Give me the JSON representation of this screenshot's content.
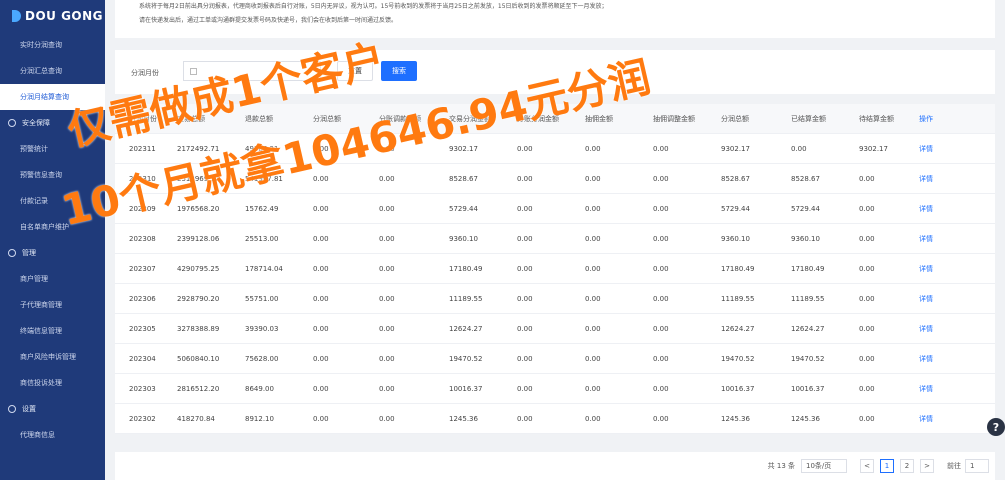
{
  "brand": "DOU GONG",
  "sidebar": {
    "items": [
      {
        "label": "实时分润查询",
        "type": "item"
      },
      {
        "label": "分润汇总查询",
        "type": "item"
      },
      {
        "label": "分润月结算查询",
        "type": "item",
        "active": true
      },
      {
        "label": "安全保障",
        "type": "group"
      },
      {
        "label": "预警统计",
        "type": "item"
      },
      {
        "label": "预警信息查询",
        "type": "item"
      },
      {
        "label": "付款记录",
        "type": "item"
      },
      {
        "label": "自名单商户维护",
        "type": "item"
      },
      {
        "label": "管理",
        "type": "group"
      },
      {
        "label": "商户管理",
        "type": "item"
      },
      {
        "label": "子代理商管理",
        "type": "item"
      },
      {
        "label": "终端信息管理",
        "type": "item"
      },
      {
        "label": "商户风险申诉管理",
        "type": "item"
      },
      {
        "label": "商信投诉处理",
        "type": "item"
      },
      {
        "label": "设置",
        "type": "group"
      },
      {
        "label": "代理商信息",
        "type": "item"
      }
    ]
  },
  "notice": {
    "line1": "系统将于每月2日前出具分润报表，代理商收到报表后自行对账，5日内无异议，视为认可。15号前收到的发票将于当月25日之前发放，15日后收到的发票将顺延至下一月发放；",
    "line2": "请在快递发出后，通过工单或沟通群提交发票号码及快递号，我们会在收到后第一时间通过反馈。"
  },
  "filter": {
    "label": "分润月份",
    "reset": "重置",
    "search": "搜索"
  },
  "table": {
    "headers": [
      "分润月份",
      "交易总额",
      "退款总额",
      "分润总额",
      "分账调款总额",
      "交易分润金额",
      "分账分润金额",
      "抽佣金额",
      "抽佣调整金额",
      "分润总额",
      "已结算金额",
      "待结算金额",
      "操作"
    ],
    "rows": [
      [
        "202311",
        "2172492.71",
        "49386.21",
        "0.00",
        "0.00",
        "9302.17",
        "0.00",
        "0.00",
        "0.00",
        "9302.17",
        "0.00",
        "9302.17",
        "详情"
      ],
      [
        "202310",
        "2513969.77",
        "541967.81",
        "0.00",
        "0.00",
        "8528.67",
        "0.00",
        "0.00",
        "0.00",
        "8528.67",
        "8528.67",
        "0.00",
        "详情"
      ],
      [
        "202309",
        "1976568.20",
        "15762.49",
        "0.00",
        "0.00",
        "5729.44",
        "0.00",
        "0.00",
        "0.00",
        "5729.44",
        "5729.44",
        "0.00",
        "详情"
      ],
      [
        "202308",
        "2399128.06",
        "25513.00",
        "0.00",
        "0.00",
        "9360.10",
        "0.00",
        "0.00",
        "0.00",
        "9360.10",
        "9360.10",
        "0.00",
        "详情"
      ],
      [
        "202307",
        "4290795.25",
        "178714.04",
        "0.00",
        "0.00",
        "17180.49",
        "0.00",
        "0.00",
        "0.00",
        "17180.49",
        "17180.49",
        "0.00",
        "详情"
      ],
      [
        "202306",
        "2928790.20",
        "55751.00",
        "0.00",
        "0.00",
        "11189.55",
        "0.00",
        "0.00",
        "0.00",
        "11189.55",
        "11189.55",
        "0.00",
        "详情"
      ],
      [
        "202305",
        "3278388.89",
        "39390.03",
        "0.00",
        "0.00",
        "12624.27",
        "0.00",
        "0.00",
        "0.00",
        "12624.27",
        "12624.27",
        "0.00",
        "详情"
      ],
      [
        "202304",
        "5060840.10",
        "75628.00",
        "0.00",
        "0.00",
        "19470.52",
        "0.00",
        "0.00",
        "0.00",
        "19470.52",
        "19470.52",
        "0.00",
        "详情"
      ],
      [
        "202303",
        "2816512.20",
        "8649.00",
        "0.00",
        "0.00",
        "10016.37",
        "0.00",
        "0.00",
        "0.00",
        "10016.37",
        "10016.37",
        "0.00",
        "详情"
      ],
      [
        "202302",
        "418270.84",
        "8912.10",
        "0.00",
        "0.00",
        "1245.36",
        "0.00",
        "0.00",
        "0.00",
        "1245.36",
        "1245.36",
        "0.00",
        "详情"
      ]
    ]
  },
  "pager": {
    "total": "共 13 条",
    "size": "10条/页",
    "prev": "<",
    "pages": [
      "1",
      "2"
    ],
    "next": ">",
    "jump_label": "前往",
    "jump_value": "1"
  },
  "help": "?",
  "promo": {
    "line1": "仅需做成1个客户",
    "line2": "10个月就拿104646.94元分润",
    "color": "#ff7a10"
  }
}
